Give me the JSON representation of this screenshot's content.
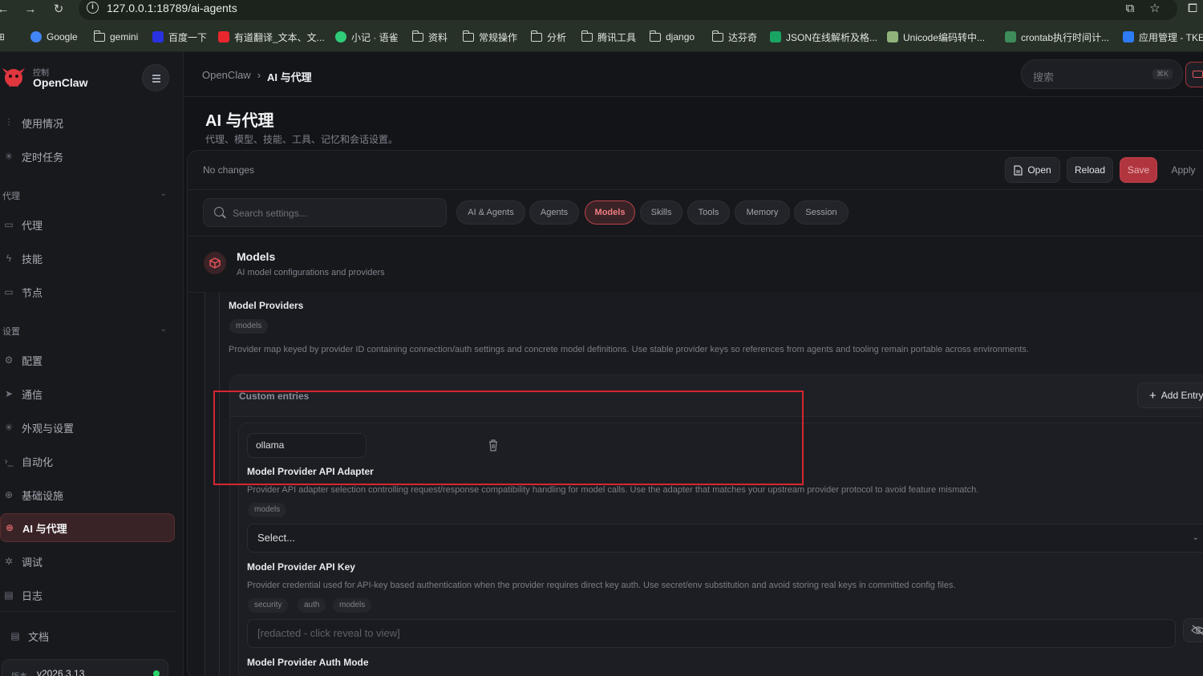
{
  "browser": {
    "url": "127.0.0.1:18789/ai-agents",
    "bookmarks": [
      {
        "label": "Google",
        "icon": "google-icon",
        "color": "#4285f4"
      },
      {
        "label": "gemini",
        "icon": "folder-icon"
      },
      {
        "label": "百度一下",
        "icon": "baidu-icon",
        "color": "#2932e1"
      },
      {
        "label": "有道翻译_文本、文...",
        "icon": "youdao-icon",
        "color": "#e8262d"
      },
      {
        "label": "小记 · 语雀",
        "icon": "yuque-icon",
        "color": "#31cc79"
      },
      {
        "label": "资料",
        "icon": "folder-icon"
      },
      {
        "label": "常规操作",
        "icon": "folder-icon"
      },
      {
        "label": "分析",
        "icon": "folder-icon"
      },
      {
        "label": "腾讯工具",
        "icon": "folder-icon"
      },
      {
        "label": "django",
        "icon": "folder-icon"
      },
      {
        "label": "达芬奇",
        "icon": "folder-icon"
      },
      {
        "label": "JSON在线解析及格...",
        "icon": "json-icon",
        "color": "#19a463"
      },
      {
        "label": "Unicode编码转中...",
        "icon": "unicode-icon",
        "color": "#8fb37a"
      },
      {
        "label": "crontab执行时间计...",
        "icon": "crontab-icon",
        "color": "#3d8c5a"
      },
      {
        "label": "应用管理 - TKE",
        "icon": "tke-icon",
        "color": "#2d7bf6"
      }
    ]
  },
  "app": {
    "brand_sub": "控制",
    "brand_name": "OpenClaw",
    "accent": "#b9444c"
  },
  "sidebar": {
    "items_top": [
      {
        "label": "使用情况",
        "icon": "bar-chart-icon"
      },
      {
        "label": "定时任务",
        "icon": "sparkle-icon"
      }
    ],
    "group_agent": "代理",
    "items_agent": [
      {
        "label": "代理",
        "icon": "folder-icon"
      },
      {
        "label": "技能",
        "icon": "bolt-icon"
      },
      {
        "label": "节点",
        "icon": "monitor-icon"
      }
    ],
    "group_settings": "设置",
    "items_settings": [
      {
        "label": "配置",
        "icon": "gear-icon"
      },
      {
        "label": "通信",
        "icon": "send-icon"
      },
      {
        "label": "外观与设置",
        "icon": "sparkle-icon"
      },
      {
        "label": "自动化",
        "icon": "terminal-icon"
      },
      {
        "label": "基础设施",
        "icon": "globe-icon"
      },
      {
        "label": "AI 与代理",
        "icon": "brain-icon",
        "active": true
      },
      {
        "label": "调试",
        "icon": "bug-icon"
      },
      {
        "label": "日志",
        "icon": "file-icon"
      }
    ],
    "docs_label": "文档",
    "version_label": "版本",
    "version_value": "v2026.3.13"
  },
  "header": {
    "crumb_root": "OpenClaw",
    "crumb_sep": "›",
    "crumb_current": "AI 与代理",
    "search_placeholder": "搜索",
    "search_kbd": "⌘K"
  },
  "page": {
    "title": "AI 与代理",
    "subtitle": "代理、模型、技能、工具、记忆和会话设置。"
  },
  "config_bar": {
    "status": "No changes",
    "open_label": "Open",
    "reload_label": "Reload",
    "save_label": "Save",
    "apply_label": "Apply"
  },
  "filter": {
    "search_placeholder": "Search settings...",
    "tabs": [
      {
        "label": "AI & Agents"
      },
      {
        "label": "Agents"
      },
      {
        "label": "Models",
        "active": true
      },
      {
        "label": "Skills"
      },
      {
        "label": "Tools"
      },
      {
        "label": "Memory"
      },
      {
        "label": "Session"
      }
    ]
  },
  "section": {
    "title": "Models",
    "subtitle": "AI model configurations and providers",
    "icon": "cube-icon"
  },
  "providers": {
    "title": "Model Providers",
    "tag": "models",
    "description": "Provider map keyed by provider ID containing connection/auth settings and concrete model definitions. Use stable provider keys so references from agents and tooling remain portable across environments.",
    "custom_entries_label": "Custom entries",
    "add_entry_label": "Add Entry",
    "entry_key": "ollama"
  },
  "fields": {
    "adapter": {
      "title": "Model Provider API Adapter",
      "description": "Provider API adapter selection controlling request/response compatibility handling for model calls. Use the adapter that matches your upstream provider protocol to avoid feature mismatch.",
      "tags": [
        "models"
      ],
      "value": "Select..."
    },
    "api_key": {
      "title": "Model Provider API Key",
      "description": "Provider credential used for API-key based authentication when the provider requires direct key auth. Use secret/env substitution and avoid storing real keys in committed config files.",
      "tags": [
        "security",
        "auth",
        "models"
      ],
      "placeholder": "[redacted - click reveal to view]"
    },
    "auth_mode": {
      "title": "Model Provider Auth Mode"
    }
  }
}
